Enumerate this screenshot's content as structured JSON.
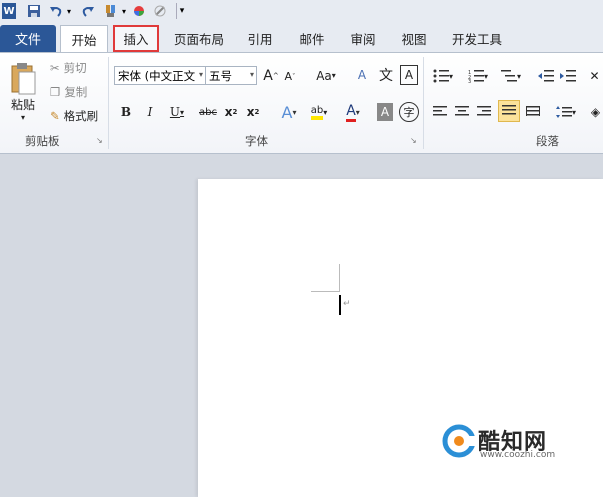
{
  "qat": {
    "word_icon": "W",
    "save_icon": "save-icon",
    "undo_icon": "undo-icon",
    "redo_icon": "redo-icon",
    "extra_dropdown": "▾"
  },
  "tabs": [
    {
      "label": "文件"
    },
    {
      "label": "开始"
    },
    {
      "label": "插入"
    },
    {
      "label": "页面布局"
    },
    {
      "label": "引用"
    },
    {
      "label": "邮件"
    },
    {
      "label": "审阅"
    },
    {
      "label": "视图"
    },
    {
      "label": "开发工具"
    }
  ],
  "clipboard": {
    "paste_label": "粘贴",
    "cut_label": "剪切",
    "copy_label": "复制",
    "format_painter_label": "格式刷",
    "group_label": "剪贴板"
  },
  "font": {
    "font_name": "宋体 (中文正文",
    "font_size": "五号",
    "grow": "A",
    "shrink": "A",
    "change_case": "Aa",
    "clear_format": "A",
    "phonetic": "文",
    "border": "A",
    "bold": "B",
    "italic": "I",
    "underline": "U",
    "strike": "abc",
    "subscript": "x",
    "superscript": "x",
    "group_label": "字体"
  },
  "paragraph": {
    "group_label": "段落"
  },
  "watermark": {
    "brand": "酷知网",
    "url": "www.coozhi.com"
  },
  "colors": {
    "file_tab": "#2b5797",
    "highlight_box": "#e03a3a",
    "page_bg": "#d4d9e1"
  }
}
